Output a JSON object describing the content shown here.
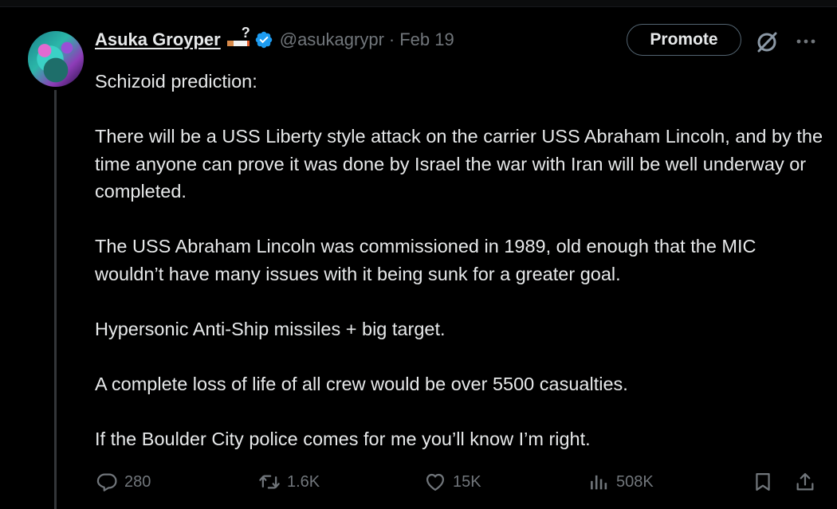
{
  "tweet": {
    "display_name": "Asuka Groyper",
    "name_emoji_text": "?",
    "handle": "@asukagrypr",
    "separator": "·",
    "date": "Feb 19",
    "promote_label": "Promote",
    "paragraphs": [
      "Schizoid prediction:",
      "There will be a USS Liberty style attack on the carrier USS Abraham Lincoln, and by the time anyone can prove it was done by Israel the war with Iran will be well underway or completed.",
      "The USS Abraham Lincoln was commissioned in 1989, old enough that the MIC wouldn’t have many issues with it being sunk for a greater goal.",
      "Hypersonic Anti-Ship missiles + big target.",
      "A complete loss of life of all crew would be over 5500 casualties.",
      "If the Boulder City police comes for me you’ll know I’m right."
    ]
  },
  "actions": {
    "replies": "280",
    "reposts": "1.6K",
    "likes": "15K",
    "views": "508K"
  },
  "icons": {
    "verified": "verified-badge-icon",
    "grok": "grok-icon",
    "more": "more-icon",
    "reply": "reply-icon",
    "repost": "repost-icon",
    "like": "heart-icon",
    "views": "views-icon",
    "bookmark": "bookmark-icon",
    "share": "share-icon"
  },
  "colors": {
    "background": "#000000",
    "text": "#e7e9ea",
    "muted": "#71767b",
    "verified": "#1d9bf0",
    "border": "#536471"
  }
}
